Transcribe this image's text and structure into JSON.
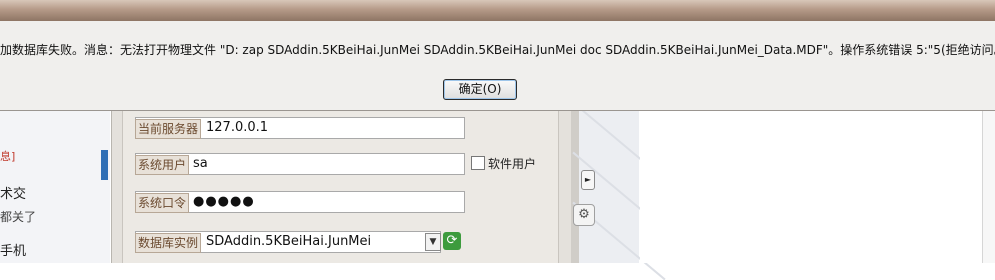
{
  "dialog": {
    "message": "加数据库失败。消息：无法打开物理文件 \"D: zap SDAddin.5KBeiHai.JunMei SDAddin.5KBeiHai.JunMei doc SDAddin.5KBeiHai.JunMei_Data.MDF\"。操作系统错误 5:\"5(拒绝访问。",
    "ok_label": "确定(O)"
  },
  "login": {
    "server_label": "当前服务器",
    "server_value": "127.0.0.1",
    "user_label": "系统用户",
    "user_value": "sa",
    "password_label": "系统口令",
    "password_value": "●●●●●",
    "db_label": "数据库实例",
    "db_value": "SDAddin.5KBeiHai.JunMei",
    "soft_user_label": "软件用户"
  },
  "background_text": {
    "frag1": "息]",
    "frag2": "术交",
    "frag3": "都关了",
    "frag4": "手机"
  },
  "icons": {
    "dropdown": "chevron-down-icon",
    "refresh": "refresh-icon",
    "side_arrow": "chevron-right-icon",
    "gear": "gear-icon"
  },
  "colors": {
    "titlebar": "#a88d7b",
    "label_text": "#6b4a2f",
    "accent_strip": "#2f6fb5"
  }
}
